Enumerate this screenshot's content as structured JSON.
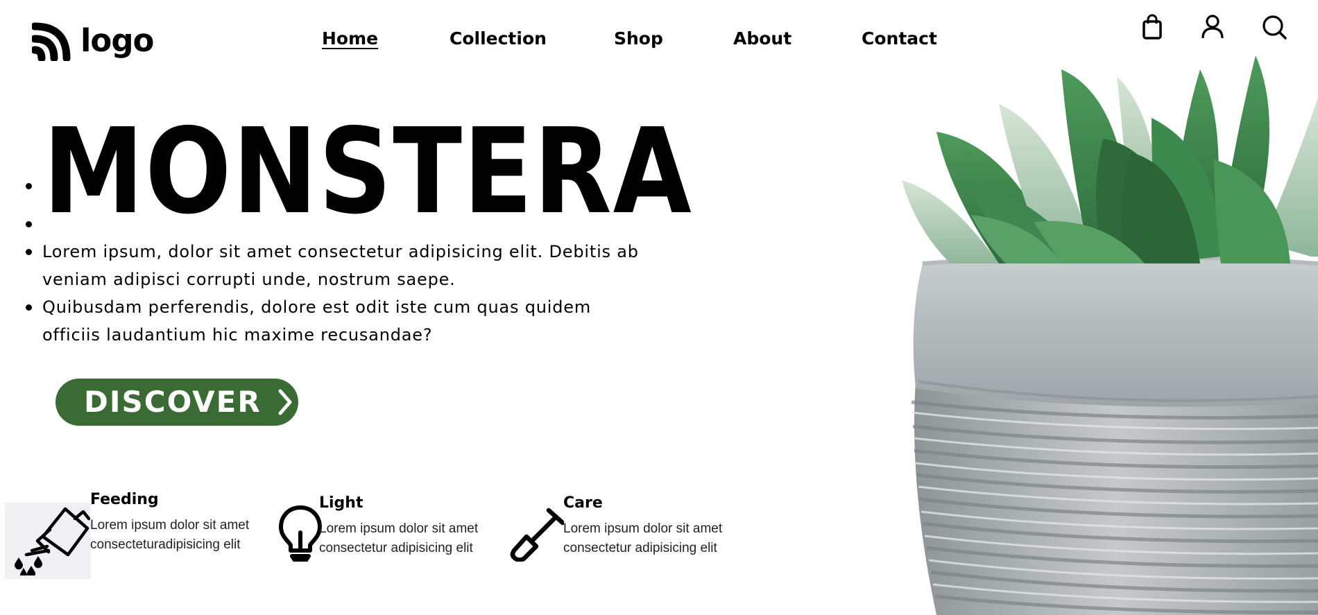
{
  "header": {
    "logo_text": "logo",
    "nav": [
      {
        "label": "Home",
        "active": true
      },
      {
        "label": "Collection",
        "active": false
      },
      {
        "label": "Shop",
        "active": false
      },
      {
        "label": "About",
        "active": false
      },
      {
        "label": "Contact",
        "active": false
      }
    ],
    "icons": [
      "shopping-bag-icon",
      "user-icon",
      "search-icon"
    ]
  },
  "hero": {
    "title": "MONSTERA",
    "paragraphs": [
      "Lorem ipsum, dolor sit amet consectetur adipisicing elit. Debitis ab veniam adipisci corrupti unde, nostrum saepe.",
      "Quibusdam perferendis, dolore est odit iste cum quas quidem officiis laudantium hic maxime recusandae?"
    ],
    "cta_label": "DISCOVER"
  },
  "features": [
    {
      "icon": "watering-can-icon",
      "title": "Feeding",
      "desc": "Lorem ipsum dolor sit amet consecteturadipisicing elit"
    },
    {
      "icon": "light-bulb-icon",
      "title": "Light",
      "desc": "Lorem ipsum dolor sit amet consectetur adipisicing elit"
    },
    {
      "icon": "shovel-icon",
      "title": "Care",
      "desc": "Lorem ipsum dolor sit amet consectetur adipisicing elit"
    }
  ],
  "colors": {
    "accent_green": "#3a6b35",
    "text": "#000000",
    "background": "#ffffff"
  }
}
